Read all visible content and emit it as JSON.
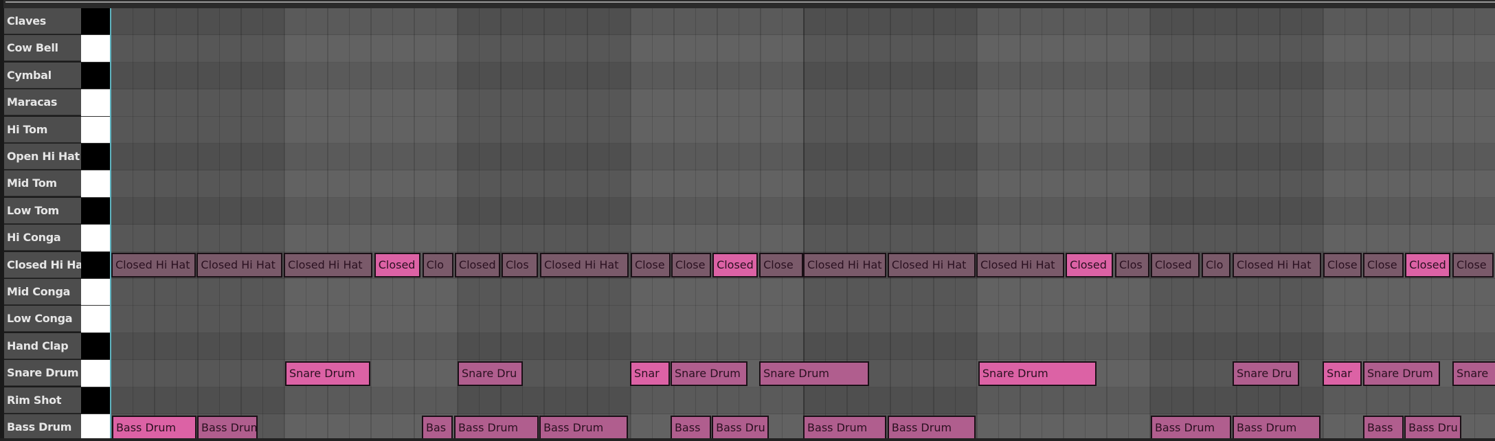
{
  "app": "Drum Rack Piano Roll",
  "colors": {
    "note_high": "#dc62a5",
    "note_mid": "#b05e8e",
    "note_low": "#7a5a6a",
    "key_white": "#ffffff",
    "key_black": "#000000",
    "playhead": "#5fb3bf"
  },
  "rows": [
    {
      "label": "Claves",
      "key": "black"
    },
    {
      "label": "Cow Bell",
      "key": "white"
    },
    {
      "label": "Cymbal",
      "key": "black"
    },
    {
      "label": "Maracas",
      "key": "white"
    },
    {
      "label": "Hi Tom",
      "key": "white"
    },
    {
      "label": "Open Hi Hat",
      "key": "black"
    },
    {
      "label": "Mid Tom",
      "key": "white"
    },
    {
      "label": "Low Tom",
      "key": "black"
    },
    {
      "label": "Hi Conga",
      "key": "white"
    },
    {
      "label": "Closed Hi Hat",
      "key": "black"
    },
    {
      "label": "Mid Conga",
      "key": "white"
    },
    {
      "label": "Low Conga",
      "key": "white"
    },
    {
      "label": "Hand Clap",
      "key": "black"
    },
    {
      "label": "Snare Drum",
      "key": "white"
    },
    {
      "label": "Rim Shot",
      "key": "black"
    },
    {
      "label": "Bass Drum",
      "key": "white"
    }
  ],
  "notes": [
    {
      "row": 9,
      "start": 0.0,
      "len": 3.9,
      "vel": "low",
      "text": "Closed Hi Hat"
    },
    {
      "row": 9,
      "start": 3.95,
      "len": 3.95,
      "vel": "low",
      "text": "Closed Hi Hat"
    },
    {
      "row": 9,
      "start": 7.97,
      "len": 4.1,
      "vel": "low",
      "text": "Closed Hi Hat"
    },
    {
      "row": 9,
      "start": 12.15,
      "len": 2.15,
      "vel": "high",
      "text": "Closed"
    },
    {
      "row": 9,
      "start": 14.37,
      "len": 1.45,
      "vel": "low",
      "text": "Clo"
    },
    {
      "row": 9,
      "start": 15.87,
      "len": 2.1,
      "vel": "low",
      "text": "Closed"
    },
    {
      "row": 9,
      "start": 18.03,
      "len": 1.7,
      "vel": "low",
      "text": "Clos"
    },
    {
      "row": 9,
      "start": 19.81,
      "len": 4.1,
      "vel": "low",
      "text": "Closed Hi Hat"
    },
    {
      "row": 9,
      "start": 24.0,
      "len": 1.84,
      "vel": "low",
      "text": "Close"
    },
    {
      "row": 9,
      "start": 25.87,
      "len": 1.84,
      "vel": "low",
      "text": "Close"
    },
    {
      "row": 9,
      "start": 27.78,
      "len": 2.1,
      "vel": "high",
      "text": "Closed"
    },
    {
      "row": 9,
      "start": 29.94,
      "len": 2.03,
      "vel": "low",
      "text": "Close"
    },
    {
      "row": 9,
      "start": 31.97,
      "len": 3.84,
      "vel": "low",
      "text": "Closed Hi Hat"
    },
    {
      "row": 9,
      "start": 35.87,
      "len": 4.06,
      "vel": "low",
      "text": "Closed Hi Hat"
    },
    {
      "row": 9,
      "start": 39.97,
      "len": 4.06,
      "vel": "low",
      "text": "Closed Hi Hat"
    },
    {
      "row": 9,
      "start": 44.1,
      "len": 2.19,
      "vel": "high",
      "text": "Closed"
    },
    {
      "row": 9,
      "start": 44.37,
      "len": 0,
      "vel": "low",
      "text": ""
    },
    {
      "row": 9,
      "start": 46.38,
      "len": 1.6,
      "vel": "low",
      "text": "Clos"
    },
    {
      "row": 9,
      "start": 48.03,
      "len": 2.25,
      "vel": "low",
      "text": "Closed"
    },
    {
      "row": 9,
      "start": 50.38,
      "len": 1.33,
      "vel": "low",
      "text": "Clo"
    },
    {
      "row": 9,
      "start": 51.81,
      "len": 4.1,
      "vel": "low",
      "text": "Closed Hi Hat"
    },
    {
      "row": 9,
      "start": 56.0,
      "len": 1.78,
      "vel": "low",
      "text": "Close"
    },
    {
      "row": 9,
      "start": 57.84,
      "len": 1.87,
      "vel": "low",
      "text": "Close"
    },
    {
      "row": 9,
      "start": 59.78,
      "len": 2.1,
      "vel": "high",
      "text": "Closed"
    },
    {
      "row": 9,
      "start": 61.97,
      "len": 1.9,
      "vel": "low",
      "text": "Close"
    },
    {
      "row": 13,
      "start": 8.03,
      "len": 3.94,
      "vel": "high",
      "text": "Snare Drum"
    },
    {
      "row": 13,
      "start": 16.0,
      "len": 3.0,
      "vel": "mid",
      "text": "Snare Dru"
    },
    {
      "row": 13,
      "start": 23.97,
      "len": 1.84,
      "vel": "high",
      "text": "Snar"
    },
    {
      "row": 13,
      "start": 25.84,
      "len": 3.56,
      "vel": "mid",
      "text": "Snare Drum"
    },
    {
      "row": 13,
      "start": 29.94,
      "len": 5.08,
      "vel": "mid",
      "text": "Snare Drum"
    },
    {
      "row": 13,
      "start": 40.06,
      "len": 5.46,
      "vel": "high",
      "text": "Snare Drum"
    },
    {
      "row": 13,
      "start": 51.81,
      "len": 3.08,
      "vel": "mid",
      "text": "Snare Dru"
    },
    {
      "row": 13,
      "start": 55.97,
      "len": 1.81,
      "vel": "high",
      "text": "Snar"
    },
    {
      "row": 13,
      "start": 57.84,
      "len": 3.56,
      "vel": "mid",
      "text": "Snare Drum"
    },
    {
      "row": 13,
      "start": 61.97,
      "len": 2.1,
      "vel": "mid",
      "text": "Snare"
    },
    {
      "row": 15,
      "start": 0.03,
      "len": 3.9,
      "vel": "high",
      "text": "Bass Drum"
    },
    {
      "row": 15,
      "start": 3.97,
      "len": 2.79,
      "vel": "mid",
      "text": "Bass Drum"
    },
    {
      "row": 15,
      "start": 14.35,
      "len": 1.43,
      "vel": "mid",
      "text": "Bas"
    },
    {
      "row": 15,
      "start": 15.84,
      "len": 3.9,
      "vel": "mid",
      "text": "Bass Drum"
    },
    {
      "row": 15,
      "start": 19.78,
      "len": 4.1,
      "vel": "mid",
      "text": "Bass Drum"
    },
    {
      "row": 15,
      "start": 25.84,
      "len": 1.87,
      "vel": "mid",
      "text": "Bass"
    },
    {
      "row": 15,
      "start": 27.75,
      "len": 2.63,
      "vel": "mid",
      "text": "Bass Dru"
    },
    {
      "row": 15,
      "start": 31.97,
      "len": 3.84,
      "vel": "mid",
      "text": "Bass Drum"
    },
    {
      "row": 15,
      "start": 35.87,
      "len": 4.06,
      "vel": "mid",
      "text": "Bass Drum"
    },
    {
      "row": 15,
      "start": 48.03,
      "len": 3.71,
      "vel": "mid",
      "text": "Bass Drum"
    },
    {
      "row": 15,
      "start": 51.81,
      "len": 4.06,
      "vel": "mid",
      "text": "Bass Drum"
    },
    {
      "row": 15,
      "start": 57.84,
      "len": 1.87,
      "vel": "mid",
      "text": "Bass"
    },
    {
      "row": 15,
      "start": 59.75,
      "len": 2.63,
      "vel": "mid",
      "text": "Bass Dru"
    }
  ],
  "grid": {
    "steps_visible": 64,
    "steps_per_bar": 8
  }
}
